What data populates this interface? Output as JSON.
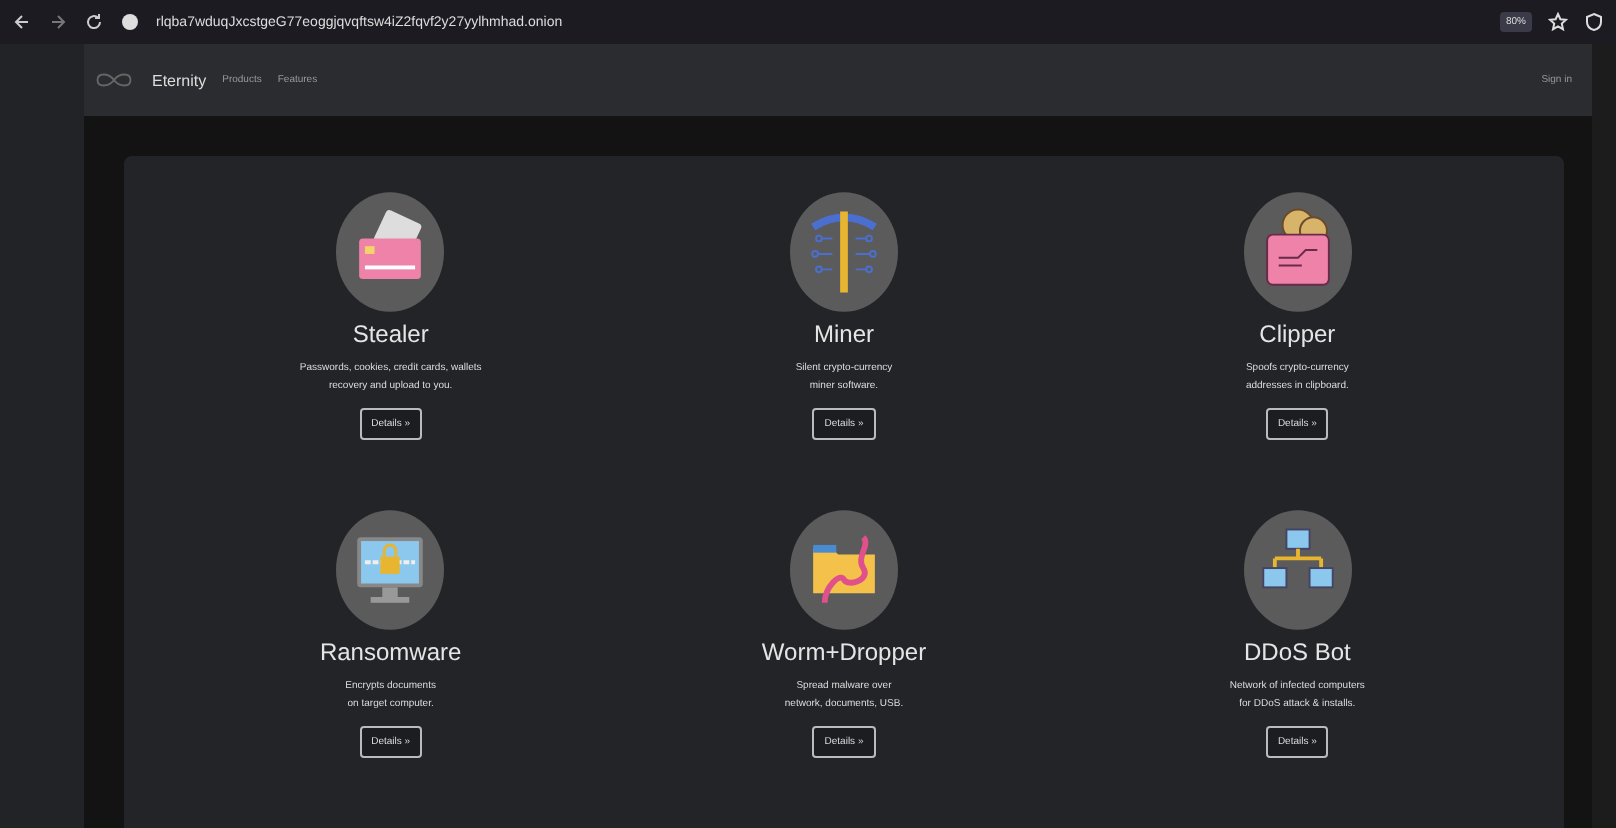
{
  "browser": {
    "url": "rlqba7wduqJxcstgeG77eoggjqvqftsw4iZ2fqvf2y27yylhmhad.onion",
    "zoom": "80%"
  },
  "nav": {
    "brand": "Eternity",
    "links": [
      "Products",
      "Features"
    ],
    "sign_in": "Sign in"
  },
  "products": [
    {
      "kind": "card",
      "title": "Stealer",
      "lines": [
        "Passwords, cookies, credit cards, wallets",
        "recovery and upload to you."
      ],
      "button": "Details »"
    },
    {
      "kind": "pickaxe",
      "title": "Miner",
      "lines": [
        "Silent crypto-currency",
        "miner software."
      ],
      "button": "Details »"
    },
    {
      "kind": "wallet",
      "title": "Clipper",
      "lines": [
        "Spoofs crypto-currency",
        "addresses in clipboard."
      ],
      "button": "Details »"
    },
    {
      "kind": "lock",
      "title": "Ransomware",
      "lines": [
        "Encrypts documents",
        "on target computer."
      ],
      "button": "Details »"
    },
    {
      "kind": "folder",
      "title": "Worm+Dropper",
      "lines": [
        "Spread malware over",
        "network, documents, USB."
      ],
      "button": "Details »"
    },
    {
      "kind": "network",
      "title": "DDoS Bot",
      "lines": [
        "Network of infected computers",
        "for DDoS attack & installs."
      ],
      "button": "Details »"
    }
  ]
}
